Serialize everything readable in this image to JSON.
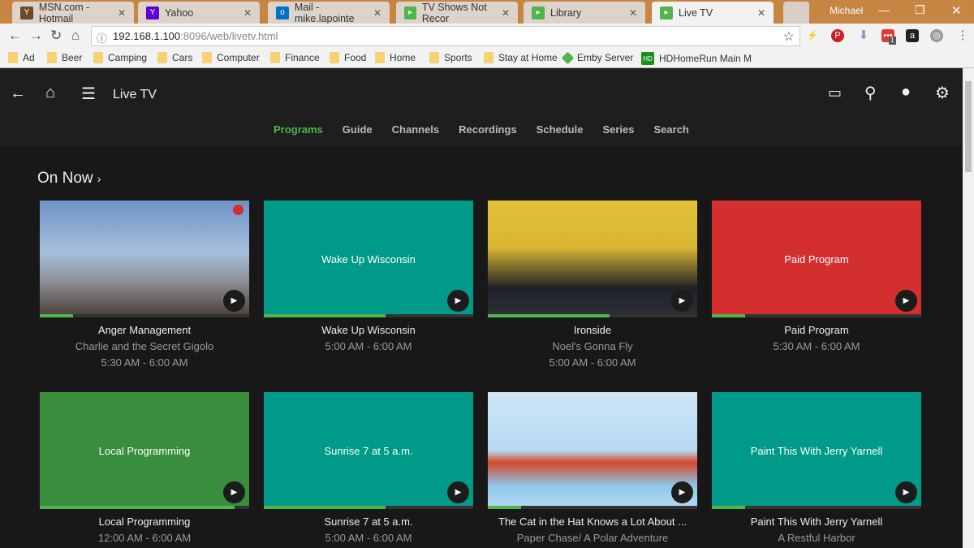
{
  "browser": {
    "tabs": [
      {
        "title": "MSN.com - Hotmail",
        "icon": "msn-icon"
      },
      {
        "title": "Yahoo",
        "icon": "yahoo-icon"
      },
      {
        "title": "Mail - mike.lapointe",
        "icon": "outlook-icon"
      },
      {
        "title": "TV Shows Not Recor",
        "icon": "emby-icon"
      },
      {
        "title": "Library",
        "icon": "emby-icon"
      },
      {
        "title": "Live TV",
        "icon": "emby-icon",
        "active": true
      }
    ],
    "profile": "Michael",
    "url_host": "192.168.1.100",
    "url_rest": ":8096/web/livetv.html",
    "ext_badge": "1",
    "bookmarks": [
      "Ad",
      "Beer",
      "Camping",
      "Cars",
      "Computer",
      "Finance",
      "Food",
      "Home",
      "Sports",
      "Stay at Home",
      "Emby Server",
      "HDHomeRun Main M"
    ]
  },
  "app": {
    "title": "Live TV",
    "tabs": [
      "Programs",
      "Guide",
      "Channels",
      "Recordings",
      "Schedule",
      "Series",
      "Search"
    ],
    "active_tab": "Programs",
    "section": "On Now",
    "accent": "#52b54b",
    "cards": [
      {
        "thumb_text": "",
        "title": "Anger Management",
        "subtitle": "Charlie and the Secret Gigolo",
        "time": "5:30 AM - 6:00 AM",
        "progress": 0.16,
        "bg": "img1",
        "recording": true
      },
      {
        "thumb_text": "Wake Up Wisconsin",
        "title": "Wake Up Wisconsin",
        "subtitle": "",
        "time": "5:00 AM - 6:00 AM",
        "progress": 0.58,
        "bg": "#009a88"
      },
      {
        "thumb_text": "",
        "title": "Ironside",
        "subtitle": "Noel's Gonna Fly",
        "time": "5:00 AM - 6:00 AM",
        "progress": 0.58,
        "bg": "img3"
      },
      {
        "thumb_text": "Paid Program",
        "title": "Paid Program",
        "subtitle": "",
        "time": "5:30 AM - 6:00 AM",
        "progress": 0.16,
        "bg": "#d32f2f"
      },
      {
        "thumb_text": "Local Programming",
        "title": "Local Programming",
        "subtitle": "",
        "time": "12:00 AM - 6:00 AM",
        "progress": 0.93,
        "bg": "#388e3c"
      },
      {
        "thumb_text": "Sunrise 7 at 5 a.m.",
        "title": "Sunrise 7 at 5 a.m.",
        "subtitle": "",
        "time": "5:00 AM - 6:00 AM",
        "progress": 0.58,
        "bg": "#009a88"
      },
      {
        "thumb_text": "",
        "title": "The Cat in the Hat Knows a Lot About ...",
        "subtitle": "Paper Chase/ A Polar Adventure",
        "time": "",
        "progress": 0.16,
        "bg": "img7"
      },
      {
        "thumb_text": "Paint This With Jerry Yarnell",
        "title": "Paint This With Jerry Yarnell",
        "subtitle": "A Restful Harbor",
        "time": "",
        "progress": 0.16,
        "bg": "#009a88"
      }
    ]
  }
}
